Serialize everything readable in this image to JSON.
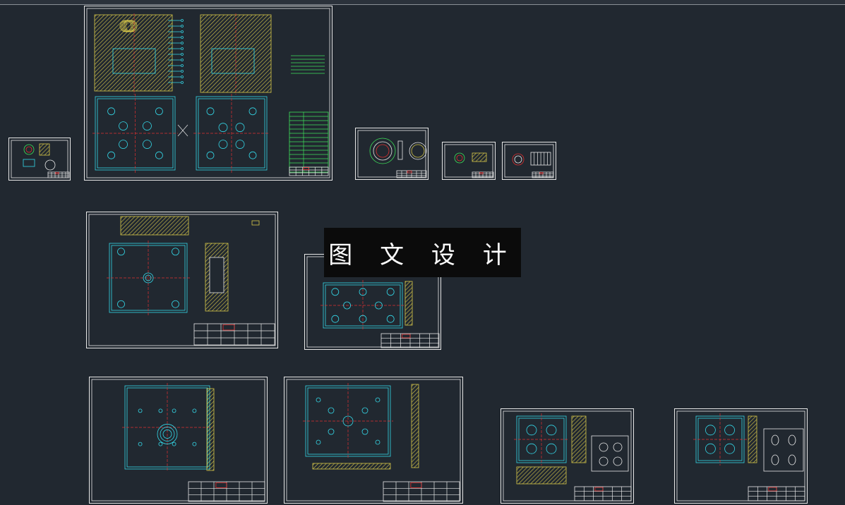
{
  "watermark": {
    "text": "图 文 设 计"
  },
  "colors": {
    "background": "#212830",
    "frame": "#e8e8e8",
    "hatch": "#d8c84a",
    "cyan": "#34d8e8",
    "red": "#e03030",
    "green": "#3ee05a",
    "magenta": "#d040d8",
    "white": "#ffffff"
  },
  "sheets": [
    {
      "id": "sheet-small-part-left",
      "kind": "small-part"
    },
    {
      "id": "sheet-assembly-drawing",
      "kind": "assembly"
    },
    {
      "id": "sheet-ring-part",
      "kind": "ring"
    },
    {
      "id": "sheet-small-part-a",
      "kind": "tiny-a"
    },
    {
      "id": "sheet-small-part-b",
      "kind": "tiny-b"
    },
    {
      "id": "sheet-plate-a",
      "kind": "plate-a"
    },
    {
      "id": "sheet-plate-b",
      "kind": "plate-b"
    },
    {
      "id": "sheet-plate-c",
      "kind": "plate-c"
    },
    {
      "id": "sheet-plate-d",
      "kind": "plate-d"
    },
    {
      "id": "sheet-cavity-e",
      "kind": "cavity-e"
    },
    {
      "id": "sheet-cavity-f",
      "kind": "cavity-f"
    }
  ]
}
